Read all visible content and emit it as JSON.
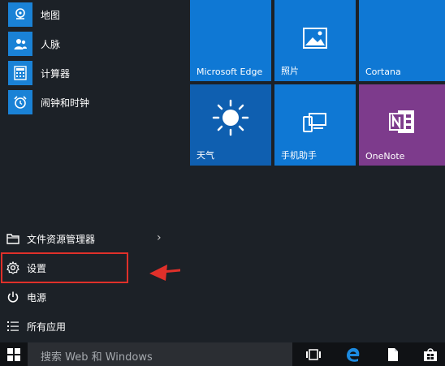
{
  "apps": [
    {
      "label": "地图",
      "icon": "map-icon"
    },
    {
      "label": "人脉",
      "icon": "people-icon"
    },
    {
      "label": "计算器",
      "icon": "calculator-icon"
    },
    {
      "label": "闹钟和时钟",
      "icon": "alarm-clock-icon"
    }
  ],
  "bottom_menu": {
    "file_explorer": "文件资源管理器",
    "settings": "设置",
    "power": "电源",
    "all_apps": "所有应用"
  },
  "tiles": [
    {
      "label": "Microsoft Edge",
      "icon": "edge-icon",
      "color": "#0f78d4"
    },
    {
      "label": "照片",
      "icon": "photos-icon",
      "color": "#0f78d4"
    },
    {
      "label": "Cortana",
      "icon": "cortana-icon",
      "color": "#0f78d4"
    },
    {
      "label": "天气",
      "icon": "sun-icon",
      "color": "#0f5fb0"
    },
    {
      "label": "手机助手",
      "icon": "phone-companion-icon",
      "color": "#0f78d4"
    },
    {
      "label": "OneNote",
      "icon": "onenote-icon",
      "color": "#7d3b8c"
    }
  ],
  "taskbar": {
    "search_placeholder": "搜索 Web 和 Windows",
    "icons": [
      "windows-logo-icon",
      "task-view-icon",
      "edge-icon",
      "file-icon",
      "store-icon"
    ]
  },
  "colors": {
    "accent": "#0f78d4",
    "highlight": "#e0302a",
    "menu_bg": "#1c2127",
    "taskbar_bg": "#101215"
  }
}
